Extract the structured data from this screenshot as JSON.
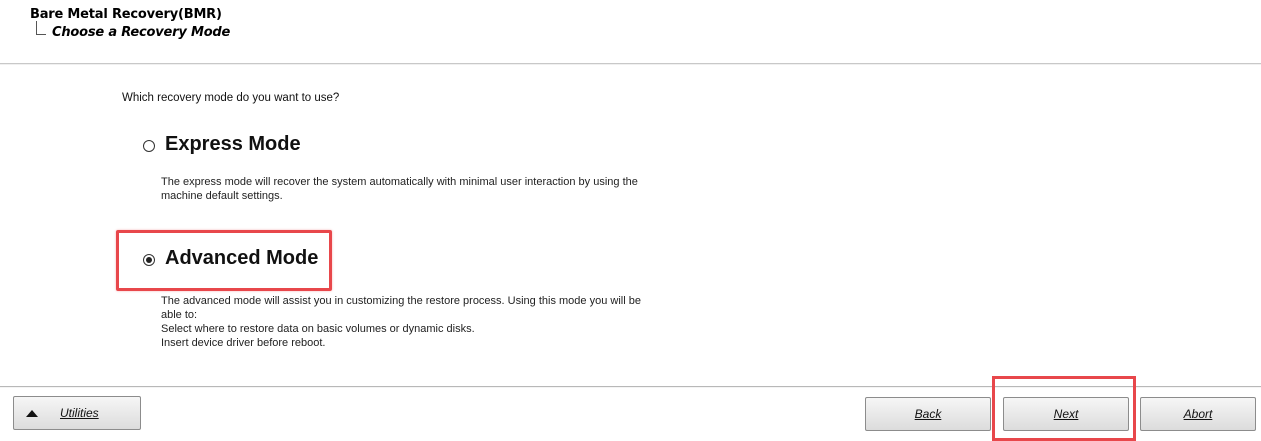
{
  "header": {
    "breadcrumb_root": "Bare Metal Recovery(BMR)",
    "breadcrumb_child": "Choose a Recovery Mode"
  },
  "main": {
    "question": "Which recovery mode do you want to use?",
    "options": [
      {
        "label": "Express Mode",
        "selected": false,
        "description": [
          "The express mode will recover the system automatically with minimal user interaction by using the",
          "machine default settings."
        ]
      },
      {
        "label": "Advanced Mode",
        "selected": true,
        "description": [
          "The advanced mode will assist you in customizing the restore process. Using this mode you will be",
          "able to:",
          "Select where to restore data on basic volumes or dynamic disks.",
          "Insert device driver before reboot."
        ]
      }
    ]
  },
  "footer": {
    "utilities_label": "Utilities",
    "back_label": "Back",
    "next_label": "Next",
    "abort_label": "Abort"
  },
  "colors": {
    "highlight": "#e8474b"
  }
}
